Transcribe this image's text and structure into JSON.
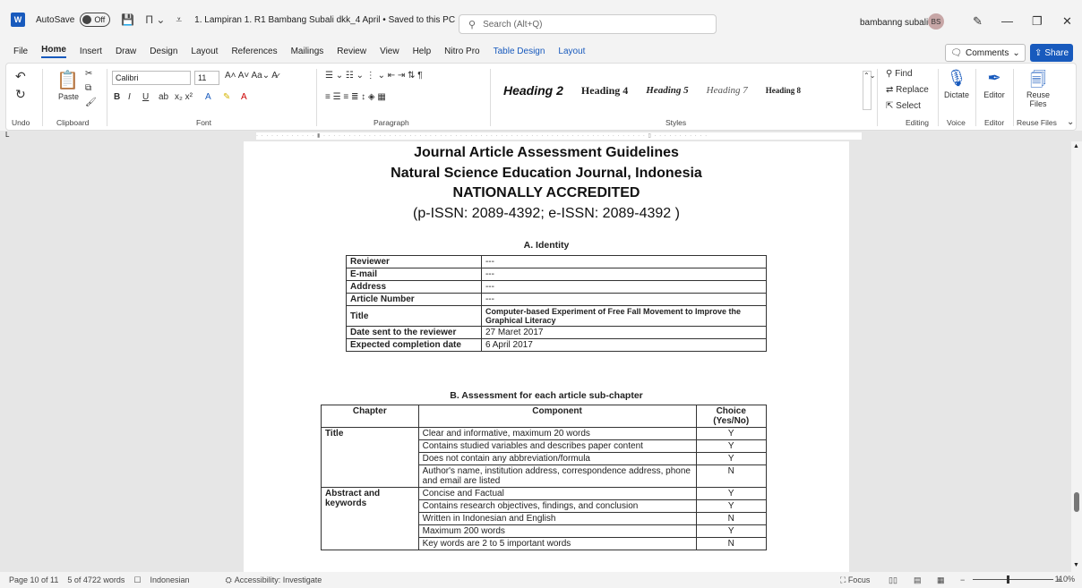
{
  "titlebar": {
    "app_logo": "W",
    "autosave_label": "AutoSave",
    "autosave_state": "Off",
    "doc_title": "1. Lampiran 1. R1 Bambang Subali dkk_4 April • Saved to this PC ⌄",
    "search_placeholder": "Search (Alt+Q)",
    "user_name": "bambanng subali",
    "user_initials": "BS"
  },
  "menu": {
    "items": [
      "File",
      "Home",
      "Insert",
      "Draw",
      "Design",
      "Layout",
      "References",
      "Mailings",
      "Review",
      "View",
      "Help",
      "Nitro Pro",
      "Table Design",
      "Layout"
    ],
    "comments": "Comments",
    "share": "Share"
  },
  "ribbon": {
    "undo_label": "Undo",
    "clipboard_label": "Clipboard",
    "paste_label": "Paste",
    "font_label": "Font",
    "font_name": "Calibri",
    "font_size": "11",
    "paragraph_label": "Paragraph",
    "styles_label": "Styles",
    "styles": [
      "Heading 2",
      "Heading 4",
      "Heading 5",
      "Heading 7",
      "Heading 8"
    ],
    "editing_label": "Editing",
    "find": "Find",
    "replace": "Replace",
    "select": "Select",
    "voice_label": "Voice",
    "dictate": "Dictate",
    "editor_group_label": "Editor",
    "editor": "Editor",
    "reuse_group_label": "Reuse Files",
    "reuse": "Reuse Files"
  },
  "document": {
    "title_lines": [
      "Journal Article Assessment Guidelines",
      "Natural Science Education Journal, Indonesia",
      "NATIONALLY ACCREDITED"
    ],
    "issn": "(p-ISSN: 2089-4392; e-ISSN: 2089-4392 )",
    "section_a": "A. Identity",
    "identity": [
      {
        "k": "Reviewer",
        "v": "---"
      },
      {
        "k": "E-mail",
        "v": "---"
      },
      {
        "k": "Address",
        "v": "---"
      },
      {
        "k": "Article Number",
        "v": "---"
      },
      {
        "k": "Title",
        "v": "Computer-based Experiment of Free Fall Movement to Improve the Graphical Literacy"
      },
      {
        "k": "Date sent to the reviewer",
        "v": "27 Maret 2017"
      },
      {
        "k": "Expected completion date",
        "v": "6 April 2017"
      }
    ],
    "section_b": "B. Assessment for each article sub-chapter",
    "assess_headers": [
      "Chapter",
      "Component",
      "Choice (Yes/No)"
    ],
    "assess_rows": [
      {
        "chapter": "Title",
        "component": "Clear and informative, maximum 20 words",
        "choice": "Y"
      },
      {
        "chapter": "",
        "component": "Contains studied variables and describes paper content",
        "choice": "Y"
      },
      {
        "chapter": "",
        "component": "Does not contain any abbreviation/formula",
        "choice": "Y"
      },
      {
        "chapter": "",
        "component": "Author's name, institution address, correspondence address, phone and email are listed",
        "choice": "N"
      },
      {
        "chapter": "Abstract and keywords",
        "component": "Concise and Factual",
        "choice": "Y"
      },
      {
        "chapter": "",
        "component": "Contains research objectives, findings, and conclusion",
        "choice": "Y"
      },
      {
        "chapter": "",
        "component": "Written in Indonesian and English",
        "choice": "N"
      },
      {
        "chapter": "",
        "component": "Maximum 200 words",
        "choice": "Y"
      },
      {
        "chapter": "",
        "component": "Key words are 2 to 5 important words",
        "choice": "N"
      }
    ]
  },
  "status": {
    "page": "Page 10 of 11",
    "words": "5 of 4722 words",
    "language": "Indonesian",
    "accessibility": "Accessibility: Investigate",
    "focus": "Focus",
    "zoom": "110%"
  }
}
